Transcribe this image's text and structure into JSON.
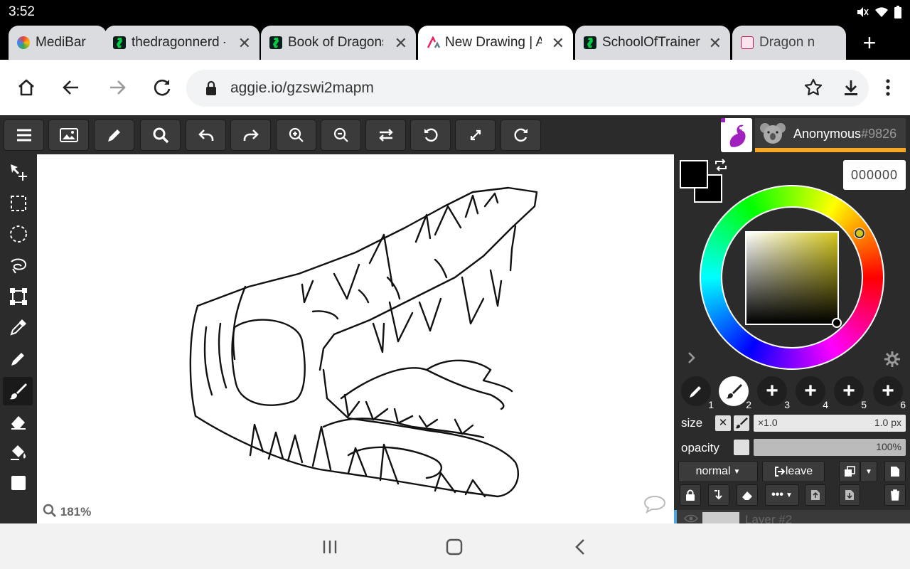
{
  "status_bar": {
    "time": "3:52",
    "icons": [
      "mute-icon",
      "wifi-icon",
      "battery-icon"
    ]
  },
  "tabs": [
    {
      "title": "MediBar",
      "favicon": "medibar-icon",
      "favicon_color": "#ea4335",
      "active": false
    },
    {
      "title": "thedragonnerd - S",
      "favicon": "deviantart-icon",
      "favicon_color": "#05cc47",
      "active": false
    },
    {
      "title": "Book of Dragons",
      "favicon": "deviantart-icon",
      "favicon_color": "#05cc47",
      "active": false
    },
    {
      "title": "New Drawing | Ag",
      "favicon": "aggie-icon",
      "favicon_color": "#e91e63",
      "active": true
    },
    {
      "title": "SchoolOfTrainers",
      "favicon": "deviantart-icon",
      "favicon_color": "#05cc47",
      "active": false
    },
    {
      "title": "Dragon n",
      "favicon": "pinterest-icon",
      "favicon_color": "#c2185b",
      "active": false
    }
  ],
  "address_bar": {
    "url": "aggie.io/gzswi2mapm"
  },
  "app_toolbar": {
    "buttons": [
      "menu-icon",
      "image-icon",
      "pencil-icon",
      "search-icon",
      "undo-icon",
      "redo-icon",
      "zoom-in-icon",
      "zoom-out-icon",
      "flip-icon",
      "rotate-left-icon",
      "fullscreen-icon",
      "rotate-right-icon"
    ]
  },
  "user": {
    "name": "Anonymous",
    "tag": "#9826",
    "accent": "#f9a825"
  },
  "left_tools": [
    "move-icon",
    "rect-select-icon",
    "ellipse-select-icon",
    "lasso-icon",
    "transform-icon",
    "eyedropper-icon",
    "pencil-tool-icon",
    "brush-icon",
    "eraser-icon",
    "fill-icon",
    "shape-icon"
  ],
  "canvas": {
    "zoom": "181%"
  },
  "color": {
    "hex": "000000",
    "primary": "#000000",
    "secondary": "#000000",
    "hue_color": "#d4c71c"
  },
  "brushes": [
    {
      "num": "1",
      "icon": "pencil-icon"
    },
    {
      "num": "2",
      "icon": "brush-icon",
      "selected": true
    },
    {
      "num": "3",
      "icon": "plus-icon"
    },
    {
      "num": "4",
      "icon": "plus-icon"
    },
    {
      "num": "5",
      "icon": "plus-icon"
    },
    {
      "num": "6",
      "icon": "plus-icon"
    }
  ],
  "size": {
    "label": "size",
    "multiplier": "×1.0",
    "value": "1.0 px"
  },
  "opacity": {
    "label": "opacity",
    "value": "100%"
  },
  "layer_controls": {
    "blend_mode": "normal",
    "leave_label": "leave"
  },
  "layers": [
    {
      "name": "Layer #2"
    }
  ]
}
